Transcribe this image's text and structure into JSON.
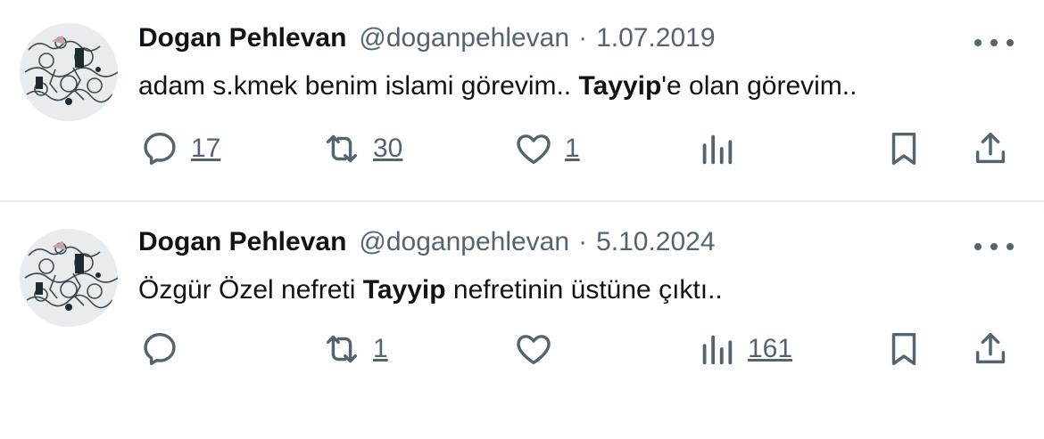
{
  "tweets": [
    {
      "author_name": "Dogan Pehlevan",
      "handle": "@doganpehlevan",
      "separator": "·",
      "date": "1.07.2019",
      "text_before": "adam s.kmek benim islami görevim.. ",
      "text_bold": "Tayyip",
      "text_after": "'e olan görevim..",
      "replies": "17",
      "retweets": "30",
      "likes": "1",
      "views": ""
    },
    {
      "author_name": "Dogan Pehlevan",
      "handle": "@doganpehlevan",
      "separator": "·",
      "date": "5.10.2024",
      "text_before": "Özgür Özel nefreti ",
      "text_bold": "Tayyip",
      "text_after": " nefretinin üstüne çıktı..",
      "replies": "",
      "retweets": "1",
      "likes": "",
      "views": "161"
    }
  ],
  "colors": {
    "text": "#0f1419",
    "secondary": "#536471",
    "divider": "#e6ecf0"
  },
  "icons": [
    "reply-icon",
    "retweet-icon",
    "like-icon",
    "views-icon",
    "bookmark-icon",
    "share-icon",
    "more-icon"
  ]
}
